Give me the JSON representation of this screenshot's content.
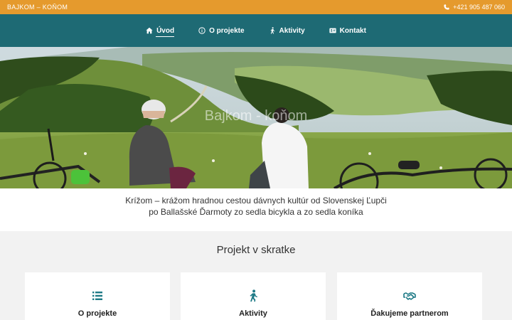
{
  "topbar": {
    "brand": "BAJKOM – KOŇOM",
    "phone": "+421 905 487 060"
  },
  "nav": [
    {
      "label": "Úvod",
      "icon": "home-icon",
      "active": true
    },
    {
      "label": "O projekte",
      "icon": "info-circle-icon",
      "active": false
    },
    {
      "label": "Aktivity",
      "icon": "walking-icon",
      "active": false
    },
    {
      "label": "Kontakt",
      "icon": "id-card-icon",
      "active": false
    }
  ],
  "hero": {
    "title": "Bajkom - koňom"
  },
  "tagline": {
    "line1": "Krížom – krážom hradnou cestou dávnych kultúr od Slovenskej Ľupči",
    "line2": "po Ballašské Ďarmoty zo sedla bicykla a zo sedla koníka"
  },
  "section": {
    "title": "Projekt v skratke"
  },
  "cards": [
    {
      "title": "O projekte",
      "icon": "list-icon"
    },
    {
      "title": "Aktivity",
      "icon": "walking-icon"
    },
    {
      "title": "Ďakujeme partnerom",
      "icon": "handshake-icon"
    }
  ],
  "colors": {
    "topbar": "#e59a2d",
    "nav": "#1e6a74",
    "accent": "#1e7a86"
  }
}
